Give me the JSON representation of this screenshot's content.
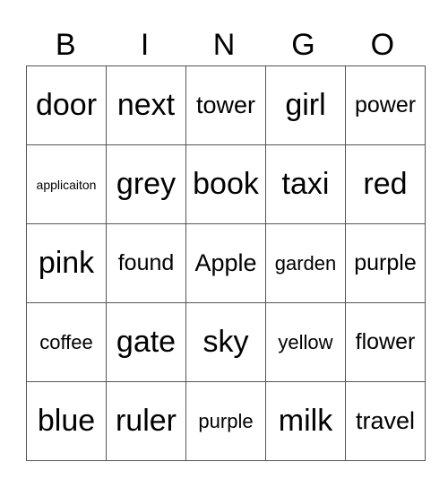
{
  "header": [
    "B",
    "I",
    "N",
    "G",
    "O"
  ],
  "cells": [
    [
      "door",
      "next",
      "tower",
      "girl",
      "power"
    ],
    [
      "applicaiton",
      "grey",
      "book",
      "taxi",
      "red"
    ],
    [
      "pink",
      "found",
      "Apple",
      "garden",
      "purple"
    ],
    [
      "coffee",
      "gate",
      "sky",
      "yellow",
      "flower"
    ],
    [
      "blue",
      "ruler",
      "purple",
      "milk",
      "travel"
    ]
  ]
}
